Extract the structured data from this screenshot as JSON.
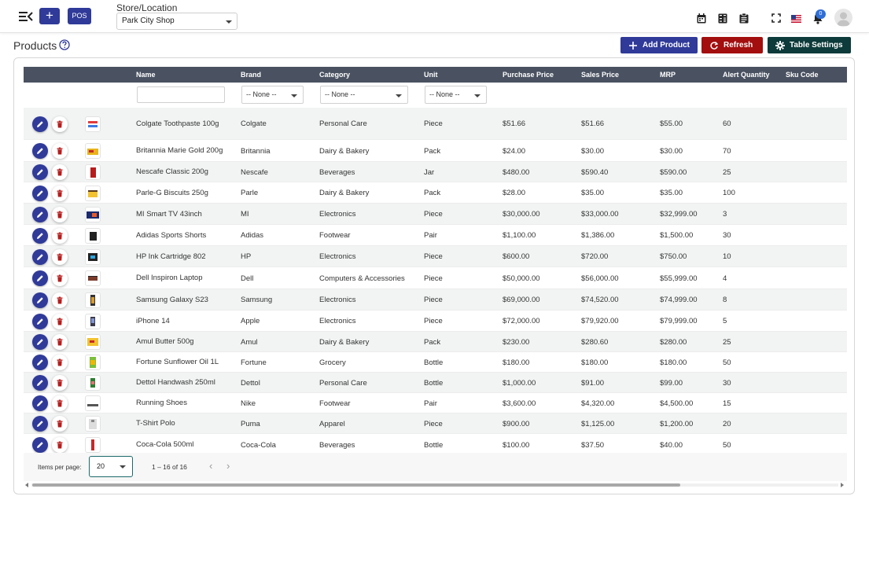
{
  "topbar": {
    "pos_label": "POS",
    "store_label": "Store/Location",
    "store_value": "Park City Shop",
    "notification_count": "0",
    "icons": [
      "menu-toggle-icon",
      "plus-icon",
      "calendar-icon",
      "calculator-icon",
      "clipboard-icon",
      "fullscreen-icon",
      "us-flag-icon",
      "bell-icon",
      "user-avatar"
    ]
  },
  "page": {
    "title": "Products",
    "add_label": "Add Product",
    "refresh_label": "Refresh",
    "settings_label": "Table Settings"
  },
  "colors": {
    "primary": "#2f3a99",
    "danger": "#a30e0e",
    "settings": "#0d3a3a",
    "header": "#4a5261"
  },
  "table": {
    "columns": [
      "Name",
      "Brand",
      "Category",
      "Unit",
      "Purchase Price",
      "Sales Price",
      "MRP",
      "Alert Quantity",
      "Sku Code"
    ],
    "filters": {
      "brand": "-- None --",
      "category": "-- None --",
      "unit": "-- None --",
      "name_placeholder": ""
    },
    "rows": [
      {
        "name": "Colgate Toothpaste 100g",
        "brand": "Colgate",
        "category": "Personal Care",
        "unit": "Piece",
        "purchase": "$51.66",
        "sales": "$51.66",
        "mrp": "$55.00",
        "alert": "60"
      },
      {
        "name": "Britannia Marie Gold 200g",
        "brand": "Britannia",
        "category": "Dairy & Bakery",
        "unit": "Pack",
        "purchase": "$24.00",
        "sales": "$30.00",
        "mrp": "$30.00",
        "alert": "70"
      },
      {
        "name": "Nescafe Classic 200g",
        "brand": "Nescafe",
        "category": "Beverages",
        "unit": "Jar",
        "purchase": "$480.00",
        "sales": "$590.40",
        "mrp": "$590.00",
        "alert": "25"
      },
      {
        "name": "Parle-G Biscuits 250g",
        "brand": "Parle",
        "category": "Dairy & Bakery",
        "unit": "Pack",
        "purchase": "$28.00",
        "sales": "$35.00",
        "mrp": "$35.00",
        "alert": "100"
      },
      {
        "name": "MI Smart TV 43inch",
        "brand": "MI",
        "category": "Electronics",
        "unit": "Piece",
        "purchase": "$30,000.00",
        "sales": "$33,000.00",
        "mrp": "$32,999.00",
        "alert": "3"
      },
      {
        "name": "Adidas Sports Shorts",
        "brand": "Adidas",
        "category": "Footwear",
        "unit": "Pair",
        "purchase": "$1,100.00",
        "sales": "$1,386.00",
        "mrp": "$1,500.00",
        "alert": "30"
      },
      {
        "name": "HP Ink Cartridge 802",
        "brand": "HP",
        "category": "Electronics",
        "unit": "Piece",
        "purchase": "$600.00",
        "sales": "$720.00",
        "mrp": "$750.00",
        "alert": "10"
      },
      {
        "name": "Dell Inspiron Laptop",
        "brand": "Dell",
        "category": "Computers & Accessories",
        "unit": "Piece",
        "purchase": "$50,000.00",
        "sales": "$56,000.00",
        "mrp": "$55,999.00",
        "alert": "4"
      },
      {
        "name": "Samsung Galaxy S23",
        "brand": "Samsung",
        "category": "Electronics",
        "unit": "Piece",
        "purchase": "$69,000.00",
        "sales": "$74,520.00",
        "mrp": "$74,999.00",
        "alert": "8"
      },
      {
        "name": "iPhone 14",
        "brand": "Apple",
        "category": "Electronics",
        "unit": "Piece",
        "purchase": "$72,000.00",
        "sales": "$79,920.00",
        "mrp": "$79,999.00",
        "alert": "5"
      },
      {
        "name": "Amul Butter 500g",
        "brand": "Amul",
        "category": "Dairy & Bakery",
        "unit": "Pack",
        "purchase": "$230.00",
        "sales": "$280.60",
        "mrp": "$280.00",
        "alert": "25"
      },
      {
        "name": "Fortune Sunflower Oil 1L",
        "brand": "Fortune",
        "category": "Grocery",
        "unit": "Bottle",
        "purchase": "$180.00",
        "sales": "$180.00",
        "mrp": "$180.00",
        "alert": "50"
      },
      {
        "name": "Dettol Handwash 250ml",
        "brand": "Dettol",
        "category": "Personal Care",
        "unit": "Bottle",
        "purchase": "$1,000.00",
        "sales": "$91.00",
        "mrp": "$99.00",
        "alert": "30"
      },
      {
        "name": "Running Shoes",
        "brand": "Nike",
        "category": "Footwear",
        "unit": "Pair",
        "purchase": "$3,600.00",
        "sales": "$4,320.00",
        "mrp": "$4,500.00",
        "alert": "15"
      },
      {
        "name": "T-Shirt Polo",
        "brand": "Puma",
        "category": "Apparel",
        "unit": "Piece",
        "purchase": "$900.00",
        "sales": "$1,125.00",
        "mrp": "$1,200.00",
        "alert": "20"
      },
      {
        "name": "Coca-Cola 500ml",
        "brand": "Coca-Cola",
        "category": "Beverages",
        "unit": "Bottle",
        "purchase": "$100.00",
        "sales": "$37.50",
        "mrp": "$40.00",
        "alert": "50"
      }
    ]
  },
  "pagination": {
    "items_per_page_label": "Items per page:",
    "items_per_page": "20",
    "range": "1 – 16 of 16",
    "prev": "‹",
    "next": "›"
  }
}
